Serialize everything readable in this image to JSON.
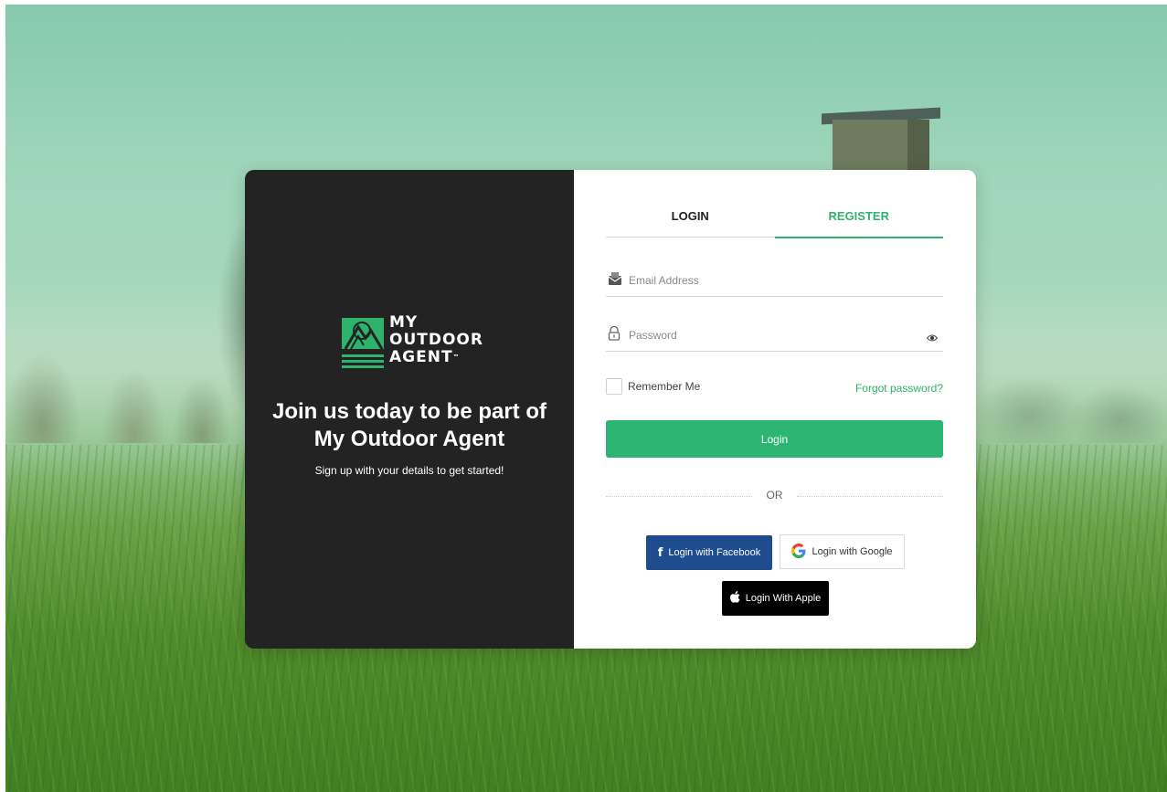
{
  "brand": {
    "logo_line1": "MY",
    "logo_line2": "OUTDOOR",
    "logo_line3": "AGENT",
    "logo_tm": "™",
    "accent_color": "#2db36b"
  },
  "left_panel": {
    "headline_line1": "Join us today to be part of",
    "headline_line2": "My Outdoor Agent",
    "subline": "Sign up with your details to get started!"
  },
  "tabs": [
    {
      "label": "LOGIN",
      "active": false
    },
    {
      "label": "REGISTER",
      "active": true
    }
  ],
  "form": {
    "email": {
      "placeholder": "Email Address",
      "value": "",
      "icon": "envelope-icon"
    },
    "password": {
      "placeholder": "Password",
      "value": "",
      "icon": "lock-icon",
      "toggle_icon": "eye-icon"
    },
    "remember_label": "Remember Me",
    "remember_checked": false,
    "forgot_label": "Forgot password?",
    "submit_label": "Login",
    "divider_label": "OR"
  },
  "social": {
    "facebook": {
      "label": "Login with Facebook",
      "icon": "facebook-icon",
      "color": "#1e4c8f"
    },
    "google": {
      "label": "Login with Google",
      "icon": "google-icon"
    },
    "apple": {
      "label": "Login With Apple",
      "icon": "apple-icon",
      "color": "#000000"
    }
  }
}
